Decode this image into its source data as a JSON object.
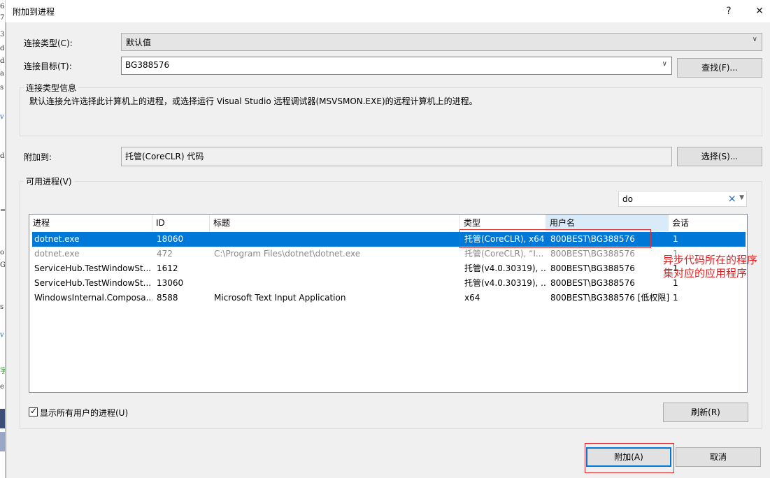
{
  "dialog": {
    "title": "附加到进程",
    "help_label": "?",
    "close_label": "✕"
  },
  "connection": {
    "type_label": "连接类型(C):",
    "type_value": "默认值",
    "target_label": "连接目标(T):",
    "target_value": "BG388576",
    "find_button": "查找(F)..."
  },
  "info": {
    "group_label": "连接类型信息",
    "text": "默认连接允许选择此计算机上的进程，或选择运行 Visual Studio 远程调试器(MSVSMON.EXE)的远程计算机上的进程。"
  },
  "attach_to": {
    "label": "附加到:",
    "value": "托管(CoreCLR) 代码",
    "select_button": "选择(S)..."
  },
  "processes": {
    "group_label": "可用进程(V)",
    "filter_value": "do",
    "columns": [
      "进程",
      "ID",
      "标题",
      "类型",
      "用户名",
      "会话"
    ],
    "rows": [
      [
        "dotnet.exe",
        "18060",
        "",
        "托管(CoreCLR), x64",
        "800BEST\\BG388576",
        "1"
      ],
      [
        "dotnet.exe",
        "472",
        "C:\\Program Files\\dotnet\\dotnet.exe",
        "托管(CoreCLR), “I...",
        "800BEST\\BG388576",
        "1"
      ],
      [
        "ServiceHub.TestWindowSt...",
        "1612",
        "",
        "托管(v4.0.30319), ...",
        "800BEST\\BG388576",
        "1"
      ],
      [
        "ServiceHub.TestWindowSt...",
        "13060",
        "",
        "托管(v4.0.30319), ...",
        "800BEST\\BG388576",
        "1"
      ],
      [
        "WindowsInternal.Composa...",
        "8588",
        "Microsoft Text Input Application",
        "x64",
        "800BEST\\BG388576 [低权限]",
        "1"
      ]
    ],
    "show_all_label": "显示所有用户的进程(U)",
    "refresh_button": "刷新(R)"
  },
  "footer": {
    "attach_button": "附加(A)",
    "cancel_button": "取消"
  },
  "annotation": {
    "line1": "异步代码所在的程序",
    "line2": "集对应的应用程序"
  },
  "colors": {
    "selection": "#0078d7",
    "annotation_red": "#e02020",
    "column_hover": "#d9ebf9"
  }
}
